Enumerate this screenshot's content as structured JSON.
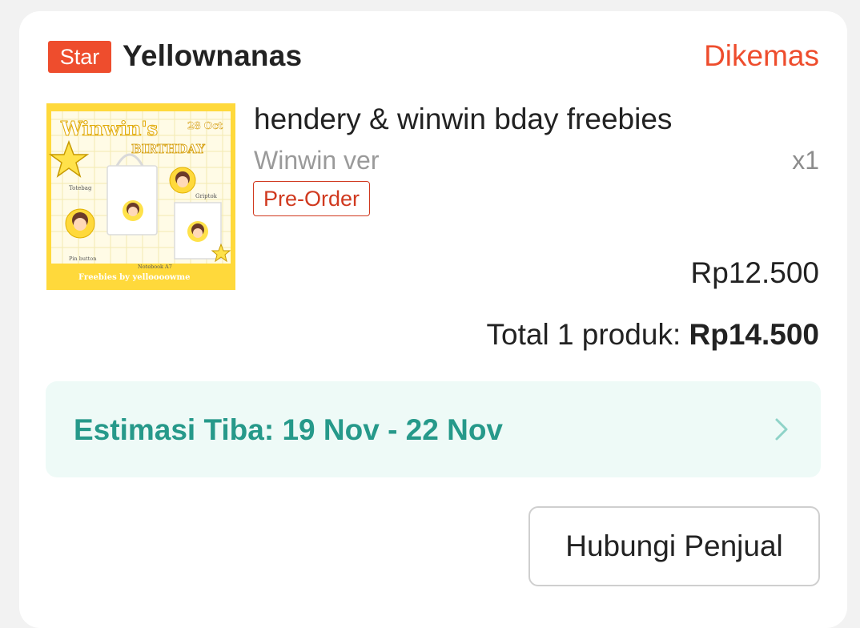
{
  "shop": {
    "badge": "Star",
    "name": "Yellownanas",
    "status": "Dikemas"
  },
  "product": {
    "title": "hendery & winwin bday freebies",
    "variant": "Winwin ver",
    "qty": "x1",
    "tag": "Pre-Order",
    "price": "Rp12.500",
    "image": {
      "title_line1": "Winwin's",
      "title_line2": "BIRTHDAY",
      "date": "28 Oct",
      "label_totebag": "Totebag",
      "label_griptok": "Griptok",
      "label_pin": "Pin button",
      "label_notebook": "Notebook A7",
      "footer": "Freebies by yelloooowme"
    }
  },
  "total": {
    "label": "Total 1 produk: ",
    "amount": "Rp14.500"
  },
  "eta": {
    "text": "Estimasi Tiba: 19 Nov - 22 Nov"
  },
  "actions": {
    "contact_seller": "Hubungi Penjual"
  },
  "colors": {
    "accent": "#ee4d2d",
    "eta_text": "#26998a",
    "eta_bg": "#eefaf7"
  }
}
